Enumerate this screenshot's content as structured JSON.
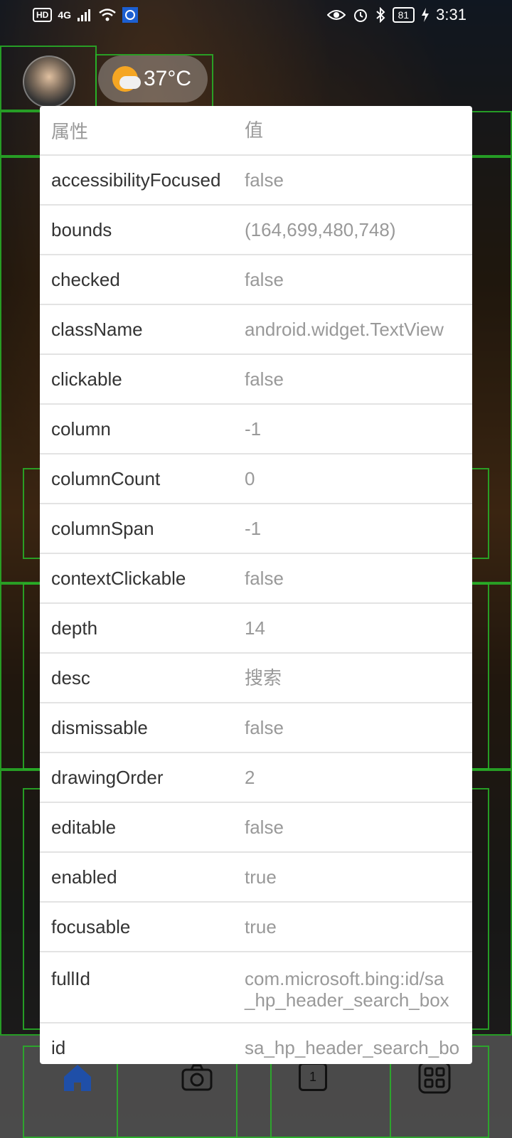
{
  "status_bar": {
    "left": {
      "hd": "HD",
      "network": "4G"
    },
    "right": {
      "battery": "81",
      "time": "3:31"
    }
  },
  "background_app": {
    "weather": {
      "temperature": "37°C"
    }
  },
  "dialog": {
    "header": {
      "key": "属性",
      "value": "值"
    },
    "rows": [
      {
        "key": "accessibilityFocused",
        "value": "false"
      },
      {
        "key": "bounds",
        "value": "(164,699,480,748)"
      },
      {
        "key": "checked",
        "value": "false"
      },
      {
        "key": "className",
        "value": "android.widget.TextView"
      },
      {
        "key": "clickable",
        "value": "false"
      },
      {
        "key": "column",
        "value": "-1"
      },
      {
        "key": "columnCount",
        "value": "0"
      },
      {
        "key": "columnSpan",
        "value": "-1"
      },
      {
        "key": "contextClickable",
        "value": "false"
      },
      {
        "key": "depth",
        "value": "14"
      },
      {
        "key": "desc",
        "value": "搜索"
      },
      {
        "key": "dismissable",
        "value": "false"
      },
      {
        "key": "drawingOrder",
        "value": "2"
      },
      {
        "key": "editable",
        "value": "false"
      },
      {
        "key": "enabled",
        "value": "true"
      },
      {
        "key": "focusable",
        "value": "true"
      },
      {
        "key": "fullId",
        "value": "com.microsoft.bing:id/sa\n_hp_header_search_box"
      },
      {
        "key": "id",
        "value": "sa_hp_header_search_bo"
      }
    ]
  },
  "bottom_nav": {
    "tab_badge": "1"
  },
  "colors": {
    "overlay_box": "#28b428",
    "dialog_bg": "#ffffff",
    "key_text": "#333333",
    "value_text": "#999999",
    "nav_home": "#1f4fa8"
  }
}
